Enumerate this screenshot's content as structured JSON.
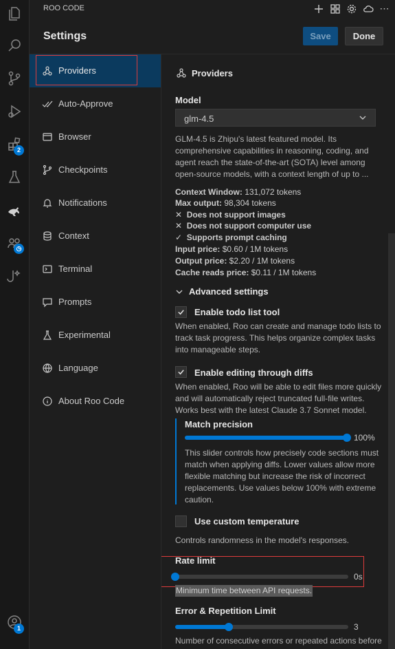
{
  "app": {
    "name": "ROO CODE"
  },
  "activity_bar": {
    "icons": [
      "explorer-icon",
      "search-icon",
      "source-control-icon",
      "run-debug-icon",
      "extensions-icon",
      "testing-icon",
      "kangaroo-icon",
      "agents-icon",
      "hook-icon",
      "account-icon"
    ],
    "extensions_badge": "2",
    "account_badge": "1"
  },
  "header": {
    "title": "Settings",
    "save_label": "Save",
    "done_label": "Done"
  },
  "nav": {
    "items": [
      {
        "label": "Providers",
        "icon": "providers-icon"
      },
      {
        "label": "Auto-Approve",
        "icon": "checks-icon"
      },
      {
        "label": "Browser",
        "icon": "browser-icon"
      },
      {
        "label": "Checkpoints",
        "icon": "branch-icon"
      },
      {
        "label": "Notifications",
        "icon": "bell-icon"
      },
      {
        "label": "Context",
        "icon": "database-icon"
      },
      {
        "label": "Terminal",
        "icon": "terminal-icon"
      },
      {
        "label": "Prompts",
        "icon": "chat-icon"
      },
      {
        "label": "Experimental",
        "icon": "flask-icon"
      },
      {
        "label": "Language",
        "icon": "globe-icon"
      },
      {
        "label": "About Roo Code",
        "icon": "info-icon"
      }
    ],
    "active": "Providers"
  },
  "main": {
    "section_title": "Providers",
    "model_label": "Model",
    "model_value": "glm-4.5",
    "model_description_lines": [
      "GLM-4.5 is Zhipu's latest featured model. Its",
      "comprehensive capabilities in reasoning, coding, and",
      "agent reach the state-of-the-art (SOTA) level among",
      "open-source models, with a context length of up to ..."
    ],
    "context_window_label": "Context Window:",
    "context_window_value": "131,072 tokens",
    "max_output_label": "Max output:",
    "max_output_value": "98,304 tokens",
    "no_images": "Does not support images",
    "no_computer_use": "Does not support computer use",
    "prompt_caching": "Supports prompt caching",
    "input_price_label": "Input price:",
    "input_price_value": "$0.60 / 1M tokens",
    "output_price_label": "Output price:",
    "output_price_value": "$2.20 / 1M tokens",
    "cache_reads_label": "Cache reads price:",
    "cache_reads_value": "$0.11 / 1M tokens",
    "advanced_label": "Advanced settings",
    "todo": {
      "label": "Enable todo list tool",
      "checked": true,
      "desc_lines": [
        "When enabled, Roo can create and manage todo lists to",
        "track task progress. This helps organize complex tasks",
        "into manageable steps."
      ]
    },
    "diffs": {
      "label": "Enable editing through diffs",
      "checked": true,
      "desc_lines": [
        "When enabled, Roo will be able to edit files more quickly",
        "and will automatically reject truncated full-file writes.",
        "Works best with the latest Claude 3.7 Sonnet model."
      ]
    },
    "match_precision": {
      "label": "Match precision",
      "value": 1.0,
      "value_text": "100%",
      "desc_lines": [
        "This slider controls how precisely code sections must",
        "match when applying diffs. Lower values allow more",
        "flexible matching but increase the risk of incorrect",
        "replacements. Use values below 100% with extreme",
        "caution."
      ]
    },
    "temperature": {
      "label": "Use custom temperature",
      "checked": false,
      "desc": "Controls randomness in the model's responses."
    },
    "rate_limit": {
      "label": "Rate limit",
      "value": 0,
      "value_text": "0s",
      "desc": "Minimum time between API requests."
    },
    "error_limit": {
      "label": "Error & Repetition Limit",
      "value_text": "3",
      "fraction": 0.31,
      "desc": "Number of consecutive errors or repeated actions before"
    }
  },
  "colors": {
    "accent": "#0078d4",
    "highlight_box": "#e03c3c",
    "active_nav": "#0b3a5e"
  }
}
